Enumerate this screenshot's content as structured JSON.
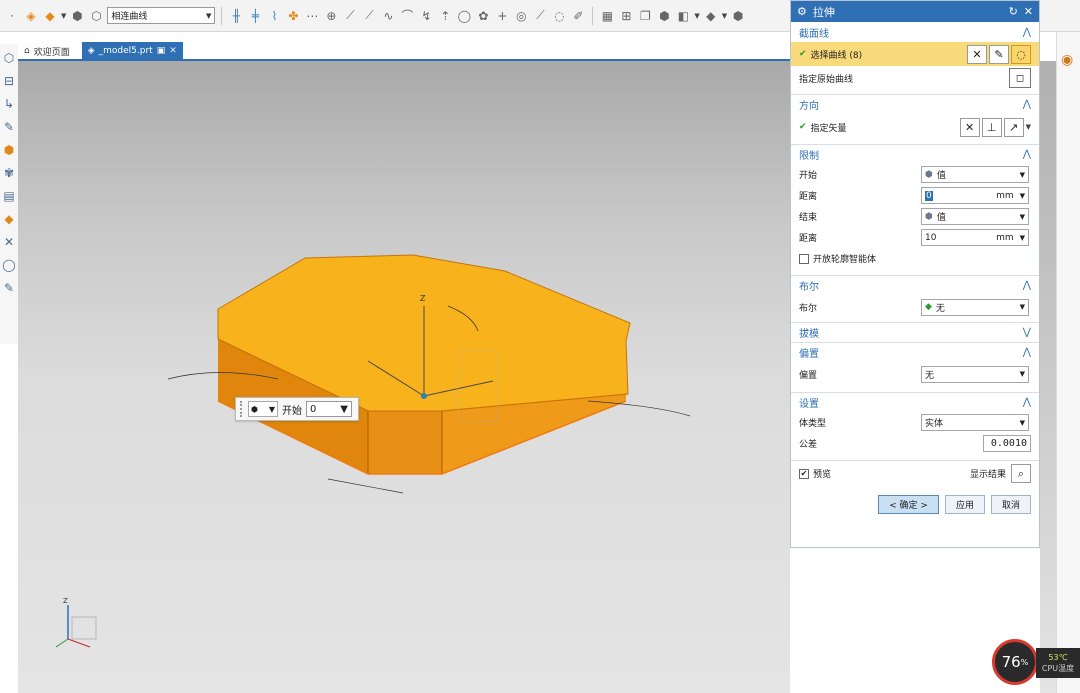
{
  "toolbar": {
    "curve_rule": "相连曲线"
  },
  "tabs": {
    "welcome": "欢迎页面",
    "model": "_model5.prt"
  },
  "startbox": {
    "label": "开始",
    "value": "0"
  },
  "dialog": {
    "title": "拉伸",
    "sections": {
      "section_curve": "截面线",
      "direction": "方向",
      "limits": "限制",
      "boolean": "布尔",
      "draft": "拔模",
      "offset": "偏置",
      "settings": "设置"
    },
    "select_curve": "选择曲线 (8)",
    "specify_origin_curve": "指定原始曲线",
    "specify_vector": "指定矢量",
    "limits": {
      "start_label": "开始",
      "start_value": "值",
      "start_distance_label": "距离",
      "start_distance": "0",
      "end_label": "结束",
      "end_value": "值",
      "end_distance_label": "距离",
      "end_distance": "10",
      "unit": "mm",
      "open_profile": "开放轮廓智能体"
    },
    "boolean": {
      "label": "布尔",
      "value": "无"
    },
    "offset": {
      "label": "偏置",
      "value": "无"
    },
    "settings": {
      "body_type_label": "体类型",
      "body_type": "实体",
      "tolerance_label": "公差",
      "tolerance": "0.0010"
    },
    "preview_label": "预览",
    "show_result": "显示结果",
    "ok": "< 确定 >",
    "apply": "应用",
    "cancel": "取消"
  },
  "cpu": {
    "percent": "76",
    "percent_sign": "%",
    "temp": "53℃",
    "temp_label": "CPU温度"
  },
  "colors": {
    "accent": "#2f6fb3",
    "highlight": "#f9da7a",
    "model_top": "#f7b21c",
    "model_side": "#e88a0e"
  }
}
